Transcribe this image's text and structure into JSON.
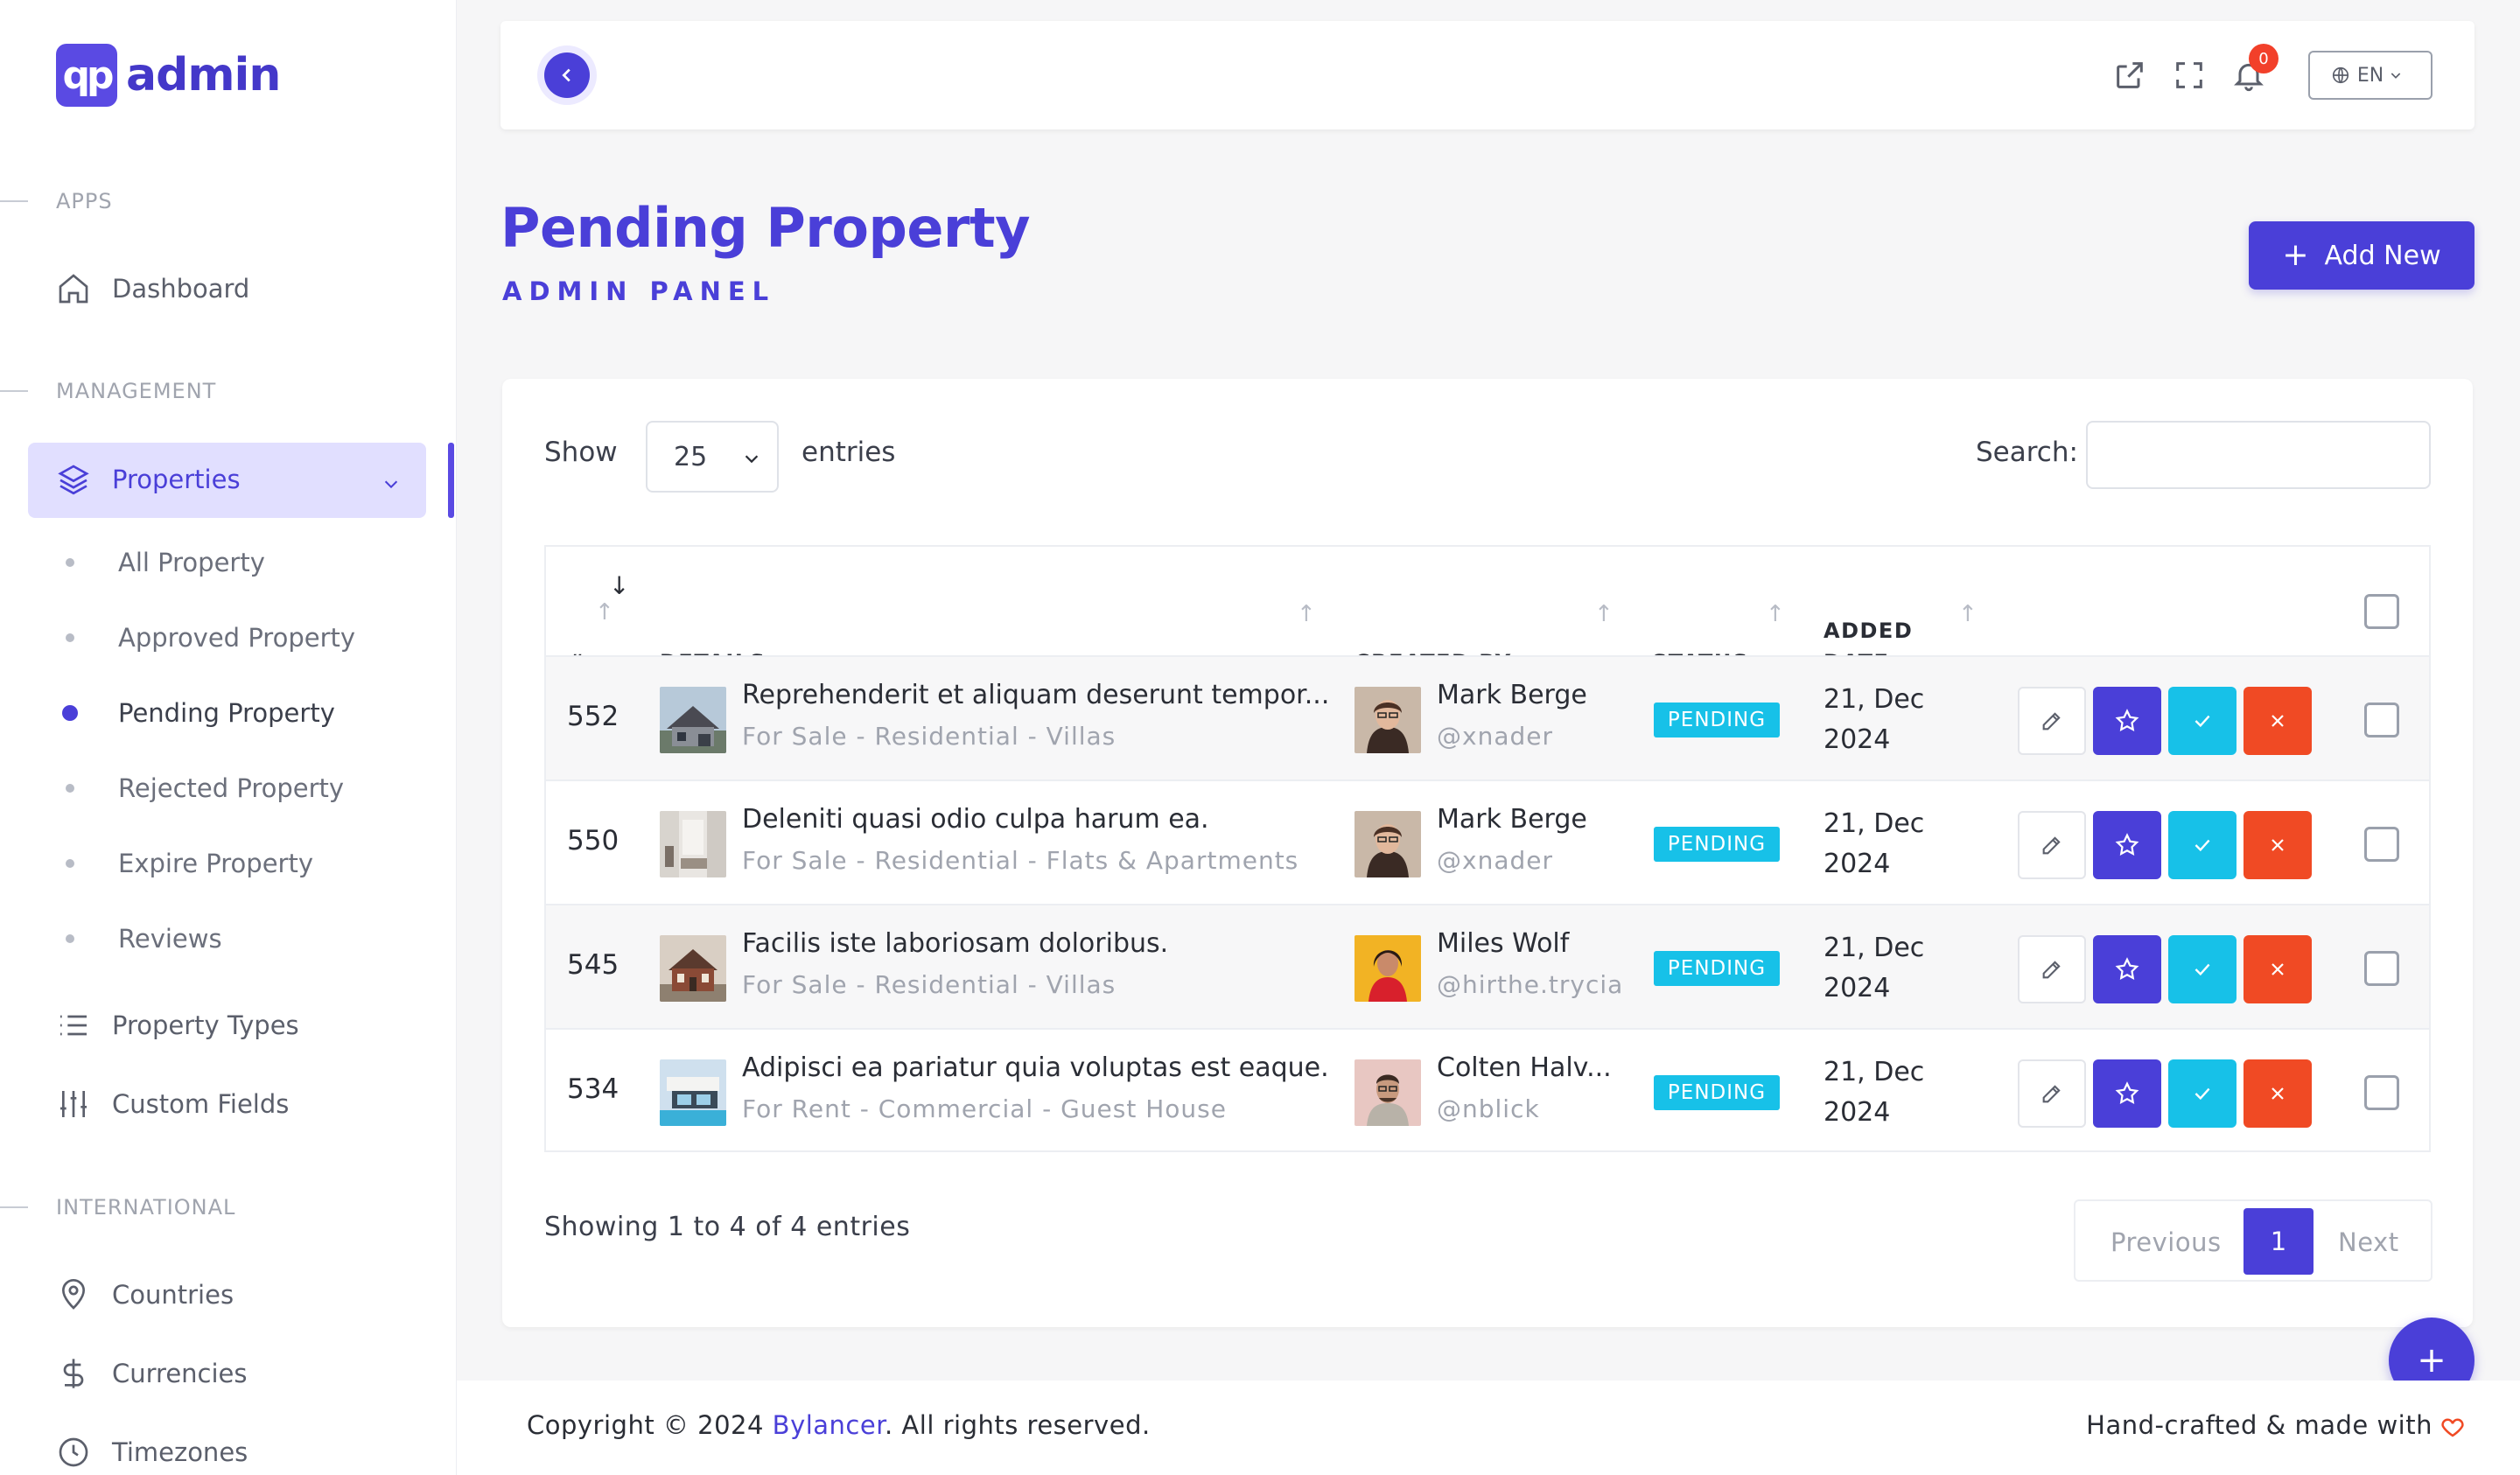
{
  "brand": {
    "logo_mark": "qp",
    "logo_text": "admin"
  },
  "sidebar": {
    "sections": [
      "APPS",
      "MANAGEMENT",
      "INTERNATIONAL"
    ],
    "dashboard": "Dashboard",
    "properties": "Properties",
    "sub_items": [
      "All Property",
      "Approved Property",
      "Pending Property",
      "Rejected Property",
      "Expire Property",
      "Reviews"
    ],
    "property_types": "Property Types",
    "custom_fields": "Custom Fields",
    "countries": "Countries",
    "currencies": "Currencies",
    "timezones": "Timezones"
  },
  "topbar": {
    "notification_count": "0",
    "language": "EN"
  },
  "header": {
    "title": "Pending Property",
    "subtitle": "ADMIN PANEL",
    "add_label": "Add New"
  },
  "table_controls": {
    "show": "Show",
    "page_length": "25",
    "entries": "entries",
    "search": "Search:",
    "search_value": ""
  },
  "columns": {
    "id": "#",
    "details": "DETAILS",
    "created_by": "CREATED BY",
    "status": "STATUS",
    "added_date_1": "ADDED",
    "added_date_2": "DATE"
  },
  "rows": [
    {
      "id": "552",
      "title": "Reprehenderit et aliquam deserunt tempor...",
      "subtitle": "For Sale - Residential - Villas",
      "creator": "Mark Berge",
      "handle": "@xnader",
      "status": "PENDING",
      "date_1": "21, Dec",
      "date_2": "2024"
    },
    {
      "id": "550",
      "title": "Deleniti quasi odio culpa harum ea.",
      "subtitle": "For Sale - Residential - Flats & Apartments",
      "creator": "Mark Berge",
      "handle": "@xnader",
      "status": "PENDING",
      "date_1": "21, Dec",
      "date_2": "2024"
    },
    {
      "id": "545",
      "title": "Facilis iste laboriosam doloribus.",
      "subtitle": "For Sale - Residential - Villas",
      "creator": "Miles Wolf",
      "handle": "@hirthe.trycia",
      "status": "PENDING",
      "date_1": "21, Dec",
      "date_2": "2024"
    },
    {
      "id": "534",
      "title": "Adipisci ea pariatur quia voluptas est eaque.",
      "subtitle": "For Rent - Commercial - Guest House",
      "creator": "Colten Halv...",
      "handle": "@nblick",
      "status": "PENDING",
      "date_1": "21, Dec",
      "date_2": "2024"
    }
  ],
  "table_info": "Showing 1 to 4 of 4 entries",
  "pagination": {
    "previous": "Previous",
    "current": "1",
    "next": "Next"
  },
  "footer": {
    "copyright_prefix": "Copyright © 2024 ",
    "brand": "Bylancer",
    "copyright_suffix": ". All rights reserved.",
    "made_with": "Hand-crafted & made with"
  },
  "colors": {
    "accent": "#4a3fd8",
    "pending": "#17c1e8",
    "danger": "#f04a24"
  }
}
